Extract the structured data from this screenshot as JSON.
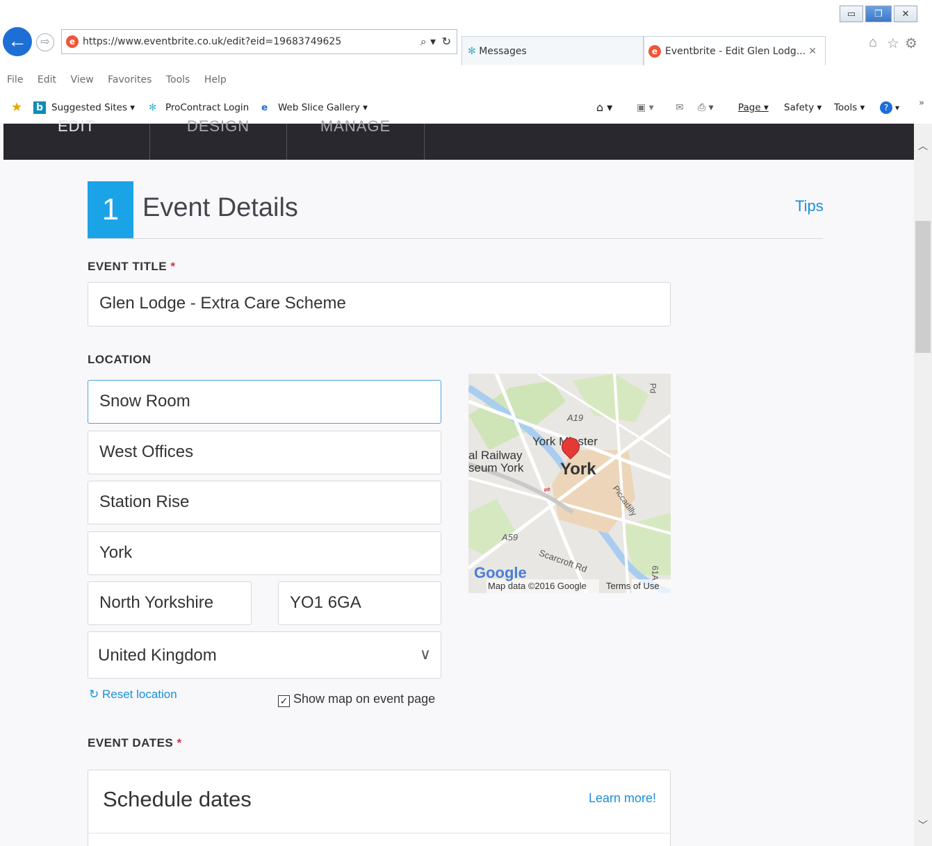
{
  "browser": {
    "url": "https://www.eventbrite.co.uk/edit?eid=19683749625",
    "tabs": [
      {
        "label": "Messages"
      },
      {
        "label": "Eventbrite - Edit Glen Lodg..."
      }
    ],
    "tab_close": "✕",
    "menu": [
      "File",
      "Edit",
      "View",
      "Favorites",
      "Tools",
      "Help"
    ],
    "favorites": {
      "suggested": "Suggested Sites ▾",
      "procontract": "ProContract Login",
      "webslice": "Web Slice Gallery ▾"
    },
    "commands": {
      "page": "Page ▾",
      "safety": "Safety ▾",
      "tools": "Tools ▾"
    }
  },
  "app_nav": {
    "items": [
      "EDIT",
      "DESIGN",
      "MANAGE"
    ]
  },
  "section": {
    "number": "1",
    "title": "Event Details",
    "tips": "Tips"
  },
  "event_title": {
    "label": "EVENT TITLE",
    "required_mark": "*",
    "value": "Glen Lodge - Extra Care Scheme"
  },
  "location": {
    "label": "LOCATION",
    "venue": "Snow Room",
    "address1": "West Offices",
    "address2": "Station Rise",
    "city": "York",
    "county": "North Yorkshire",
    "postcode": "YO1 6GA",
    "country": "United Kingdom",
    "reset": "Reset location",
    "show_map_label": "Show map on event page",
    "show_map_checked": true
  },
  "map": {
    "labels": {
      "city": "York",
      "minster": "York Minster",
      "railway": "al Railway",
      "museum": "seum York",
      "road_a19": "A19",
      "road_a59": "A59",
      "road_piccadilly": "Piccadilly",
      "road_scarcroft": "Scarcroft Rd",
      "road_a19_south": "61A",
      "road_top_right": "Pd"
    },
    "google": "Google",
    "attribution": "Map data ©2016 Google",
    "terms": "Terms of Use"
  },
  "event_dates": {
    "label": "EVENT DATES",
    "required_mark": "*",
    "schedule_title": "Schedule dates",
    "learn_more": "Learn more!"
  },
  "colors": {
    "accent": "#1ba3e8",
    "link": "#1a8fd8",
    "nav_bg": "#29282e",
    "required": "#d6314b"
  }
}
